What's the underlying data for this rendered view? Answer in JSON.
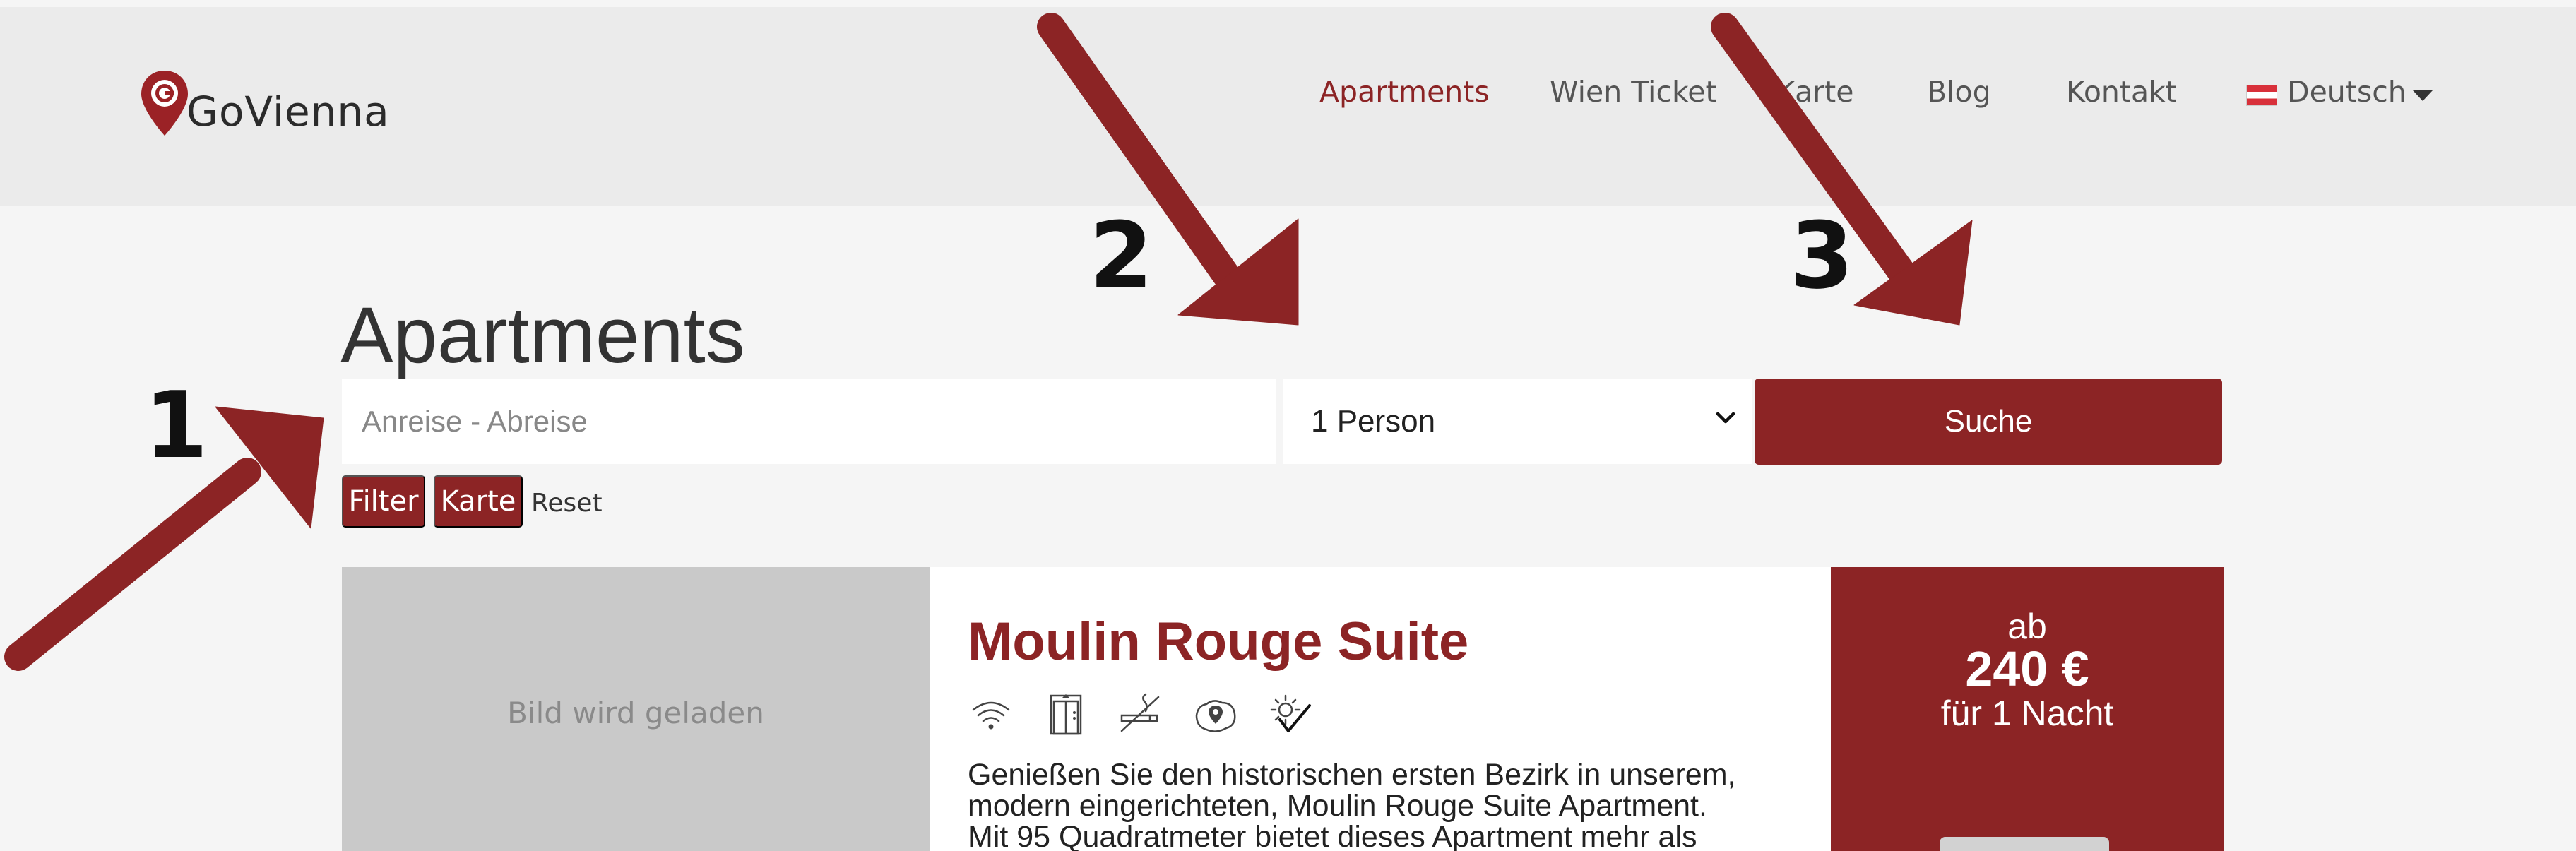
{
  "header": {
    "logo_text": "GoVienna",
    "nav": [
      {
        "label": "Apartments",
        "active": true
      },
      {
        "label": "Wien Ticket",
        "active": false
      },
      {
        "label": "Karte",
        "active": false
      },
      {
        "label": "Blog",
        "active": false
      },
      {
        "label": "Kontakt",
        "active": false
      }
    ],
    "language": "Deutsch"
  },
  "main": {
    "title": "Apartments",
    "search": {
      "date_placeholder": "Anreise - Abreise",
      "persons_value": "1 Person",
      "search_label": "Suche"
    },
    "filters": {
      "filter_label": "Filter",
      "map_label": "Karte",
      "reset_label": "Reset"
    },
    "listing": {
      "image_loading_text": "Bild wird geladen",
      "title": "Moulin Rouge Suite",
      "amenity_icons": [
        "wifi-icon",
        "elevator-icon",
        "no-smoking-icon",
        "location-map-icon",
        "checkmark-badge-icon"
      ],
      "description_lines": [
        "Genießen Sie den historischen ersten Bezirk in unserem,",
        "modern eingerichteten, Moulin Rouge Suite Apartment.",
        "Mit 95 Quadratmeter bietet dieses Apartment mehr als"
      ],
      "price_prefix": "ab",
      "price": "240 €",
      "price_suffix": "für 1 Nacht"
    }
  },
  "annotations": {
    "labels": [
      "1",
      "2",
      "3"
    ],
    "arrow_color": "#8c2425"
  },
  "colors": {
    "brand": "#8c2425",
    "header_bg": "#ebebeb",
    "page_bg": "#f5f5f5"
  }
}
